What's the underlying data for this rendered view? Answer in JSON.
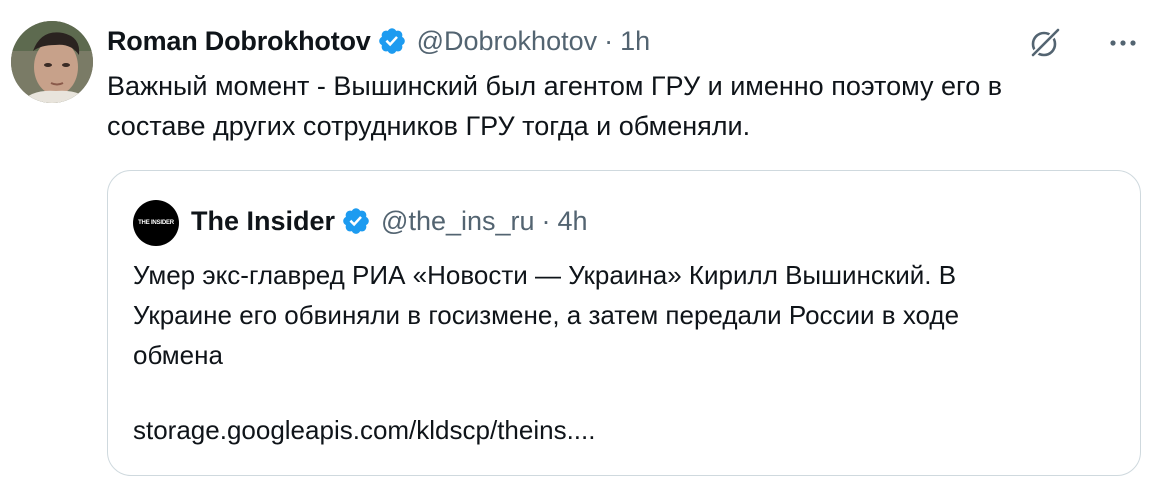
{
  "tweet": {
    "author_name": "Roman Dobrokhotov",
    "author_handle": "@Dobrokhotov",
    "separator": "·",
    "time": "1h",
    "text_lines": [
      "Важный момент - Вышинский был агентом ГРУ и именно поэтому его в",
      "составе других сотрудников ГРУ тогда и обменяли."
    ],
    "icons": {
      "verified": "verified-badge-icon",
      "grok": "grok-icon",
      "more": "more-dots-icon"
    },
    "colors": {
      "verified": "#1d9bf0",
      "secondary_text": "#536471",
      "border": "#cfd9de"
    }
  },
  "quote": {
    "avatar_text": "THE INSIDER",
    "author_name": "The Insider",
    "author_handle": "@the_ins_ru",
    "separator": "·",
    "time": "4h",
    "text_lines": [
      "Умер экс-главред РИА «Новости — Украина» Кирилл Вышинский. В",
      "Украине его обвиняли в госизмене, а затем передали России в ходе",
      "обмена"
    ],
    "link": "storage.googleapis.com/kldscp/theins...."
  }
}
